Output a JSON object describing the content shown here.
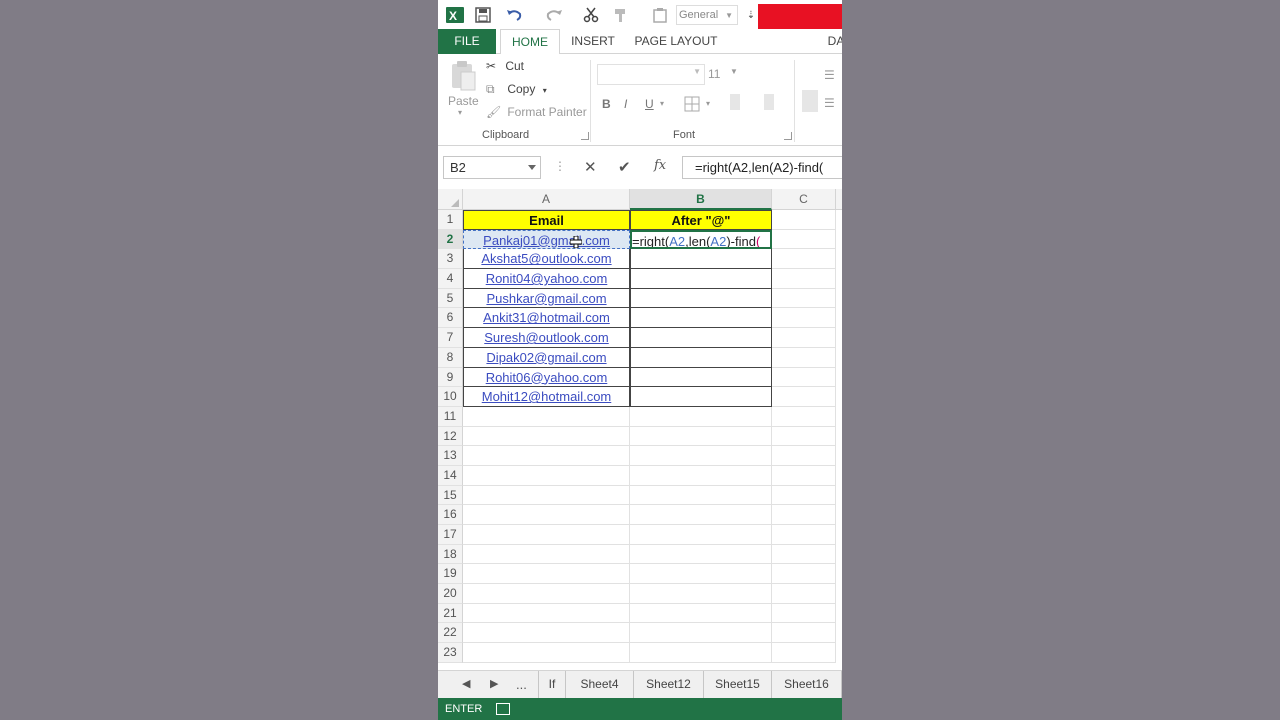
{
  "qat": {
    "number_format": "General"
  },
  "tabs": {
    "file": "FILE",
    "home": "HOME",
    "insert": "INSERT",
    "page_layout": "PAGE LAYOUT",
    "data_partial": "DA"
  },
  "ribbon": {
    "paste": "Paste",
    "cut": "Cut",
    "copy": "Copy",
    "format_painter": "Format Painter",
    "clipboard_group": "Clipboard",
    "font_size": "11",
    "bold": "B",
    "italic": "I",
    "underline": "U",
    "font_group": "Font"
  },
  "formula_bar": {
    "name_box": "B2",
    "fx": "fx",
    "formula": "=right(A2,len(A2)-find("
  },
  "columns": [
    "A",
    "B",
    "C"
  ],
  "rows": [
    {
      "n": "1",
      "a": "Email",
      "b": "After \"@\""
    },
    {
      "n": "2",
      "a": "Pankaj01@gmail.com",
      "b": ""
    },
    {
      "n": "3",
      "a": "Akshat5@outlook.com",
      "b": ""
    },
    {
      "n": "4",
      "a": "Ronit04@yahoo.com",
      "b": ""
    },
    {
      "n": "5",
      "a": "Pushkar@gmail.com",
      "b": ""
    },
    {
      "n": "6",
      "a": "Ankit31@hotmail.com",
      "b": ""
    },
    {
      "n": "7",
      "a": "Suresh@outlook.com",
      "b": ""
    },
    {
      "n": "8",
      "a": "Dipak02@gmail.com",
      "b": ""
    },
    {
      "n": "9",
      "a": "Rohit06@yahoo.com",
      "b": ""
    },
    {
      "n": "10",
      "a": "Mohit12@hotmail.com",
      "b": ""
    },
    {
      "n": "11",
      "a": "",
      "b": ""
    },
    {
      "n": "12",
      "a": "",
      "b": ""
    },
    {
      "n": "13",
      "a": "",
      "b": ""
    },
    {
      "n": "14",
      "a": "",
      "b": ""
    },
    {
      "n": "15",
      "a": "",
      "b": ""
    },
    {
      "n": "16",
      "a": "",
      "b": ""
    },
    {
      "n": "17",
      "a": "",
      "b": ""
    },
    {
      "n": "18",
      "a": "",
      "b": ""
    },
    {
      "n": "19",
      "a": "",
      "b": ""
    },
    {
      "n": "20",
      "a": "",
      "b": ""
    },
    {
      "n": "21",
      "a": "",
      "b": ""
    },
    {
      "n": "22",
      "a": "",
      "b": ""
    },
    {
      "n": "23",
      "a": "",
      "b": ""
    }
  ],
  "editing_formula": {
    "p1": "=right(",
    "ref1": "A2",
    "p2": ",len(",
    "ref2": "A2",
    "p3": ")-find",
    "p4": "("
  },
  "sheet_tabs": {
    "more": "...",
    "tabs": [
      "If",
      "Sheet4",
      "Sheet12",
      "Sheet15",
      "Sheet16"
    ]
  },
  "status": {
    "mode": "ENTER"
  },
  "colors": {
    "accent": "#217346",
    "header_fill": "#ffff00",
    "link": "#3b4cc0"
  }
}
